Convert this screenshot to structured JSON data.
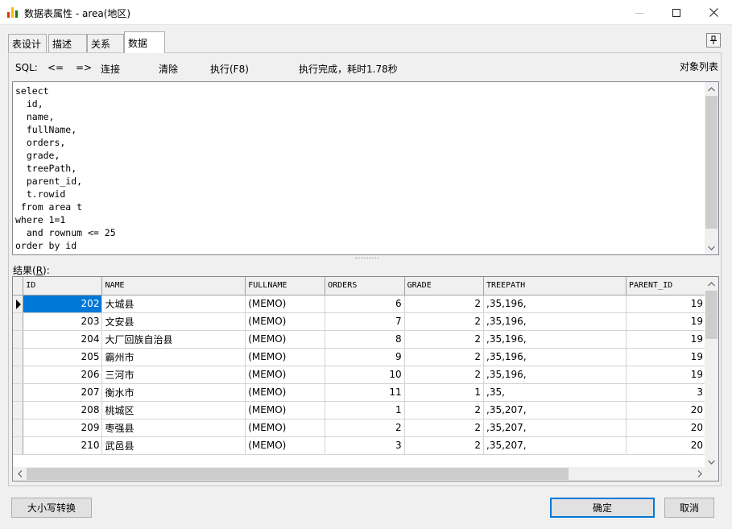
{
  "window": {
    "title": "数据表属性 - area(地区)",
    "icon_colors": [
      "#d83b01",
      "#ffb900",
      "#107c10"
    ]
  },
  "tabs": [
    {
      "label": "表设计",
      "active": false
    },
    {
      "label": "描述",
      "active": false
    },
    {
      "label": "关系",
      "active": false
    },
    {
      "label": "数据",
      "active": true
    }
  ],
  "toolbar": {
    "sql_label": "SQL:",
    "back_label": "<=",
    "forward_label": "=>",
    "connect_label": "连接",
    "clear_label": "清除",
    "execute_label": "执行(F8)",
    "status": "执行完成，耗时1.78秒",
    "object_list_label": "对象列表"
  },
  "editor": {
    "sql": "select\n  id,\n  name,\n  fullName,\n  orders,\n  grade,\n  treePath,\n  parent_id,\n  t.rowid\n from area t\nwhere 1=1\n  and rownum <= 25\norder by id"
  },
  "results": {
    "label_prefix": "结果(",
    "label_key": "R",
    "label_suffix": "):",
    "columns": [
      "ID",
      "NAME",
      "FULLNAME",
      "ORDERS",
      "GRADE",
      "TREEPATH",
      "PARENT_ID"
    ],
    "rows": [
      [
        "202",
        "大城县",
        "(MEMO)",
        "6",
        "2",
        ",35,196,",
        "19"
      ],
      [
        "203",
        "文安县",
        "(MEMO)",
        "7",
        "2",
        ",35,196,",
        "19"
      ],
      [
        "204",
        "大厂回族自治县",
        "(MEMO)",
        "8",
        "2",
        ",35,196,",
        "19"
      ],
      [
        "205",
        "霸州市",
        "(MEMO)",
        "9",
        "2",
        ",35,196,",
        "19"
      ],
      [
        "206",
        "三河市",
        "(MEMO)",
        "10",
        "2",
        ",35,196,",
        "19"
      ],
      [
        "207",
        "衡水市",
        "(MEMO)",
        "11",
        "1",
        ",35,",
        "3"
      ],
      [
        "208",
        "桃城区",
        "(MEMO)",
        "1",
        "2",
        ",35,207,",
        "20"
      ],
      [
        "209",
        "枣强县",
        "(MEMO)",
        "2",
        "2",
        ",35,207,",
        "20"
      ],
      [
        "210",
        "武邑县",
        "(MEMO)",
        "3",
        "2",
        ",35,207,",
        "20"
      ]
    ]
  },
  "buttons": {
    "case_convert": "大小写转换",
    "ok": "确定",
    "cancel": "取消"
  },
  "colors": {
    "selection": "#0078d7",
    "primary_border": "#0078d7"
  }
}
